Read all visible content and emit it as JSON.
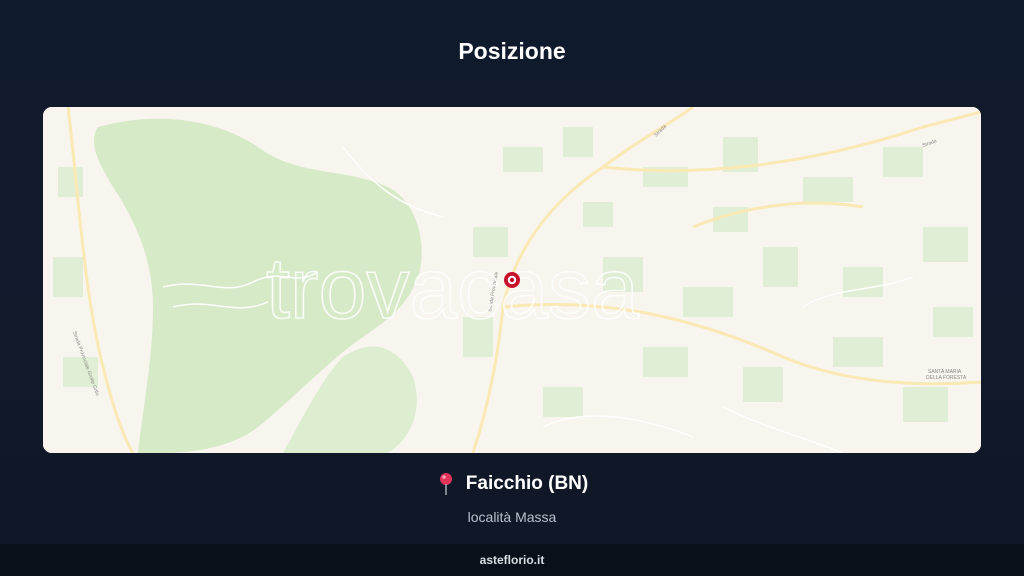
{
  "page": {
    "title": "Posizione"
  },
  "map": {
    "watermark": "trovacasa",
    "labels": {
      "road_left": "Strada Provinciale Grotte Grifo",
      "road_center": "Strada Provinciale",
      "road_top": "Strada",
      "road_top_right": "Strada",
      "place_right_line1": "SANTA MARIA",
      "place_right_line2": "DELLA FORESTA"
    },
    "colors": {
      "land": "#f8f4ee",
      "green": "#d8eccb",
      "road": "#fdf1c8",
      "marker": "#c8102e"
    }
  },
  "location": {
    "pin_icon": "map-pin-icon",
    "city": "Faicchio (BN)",
    "locality": "località Massa"
  },
  "footer": {
    "site": "asteflorio.it"
  }
}
